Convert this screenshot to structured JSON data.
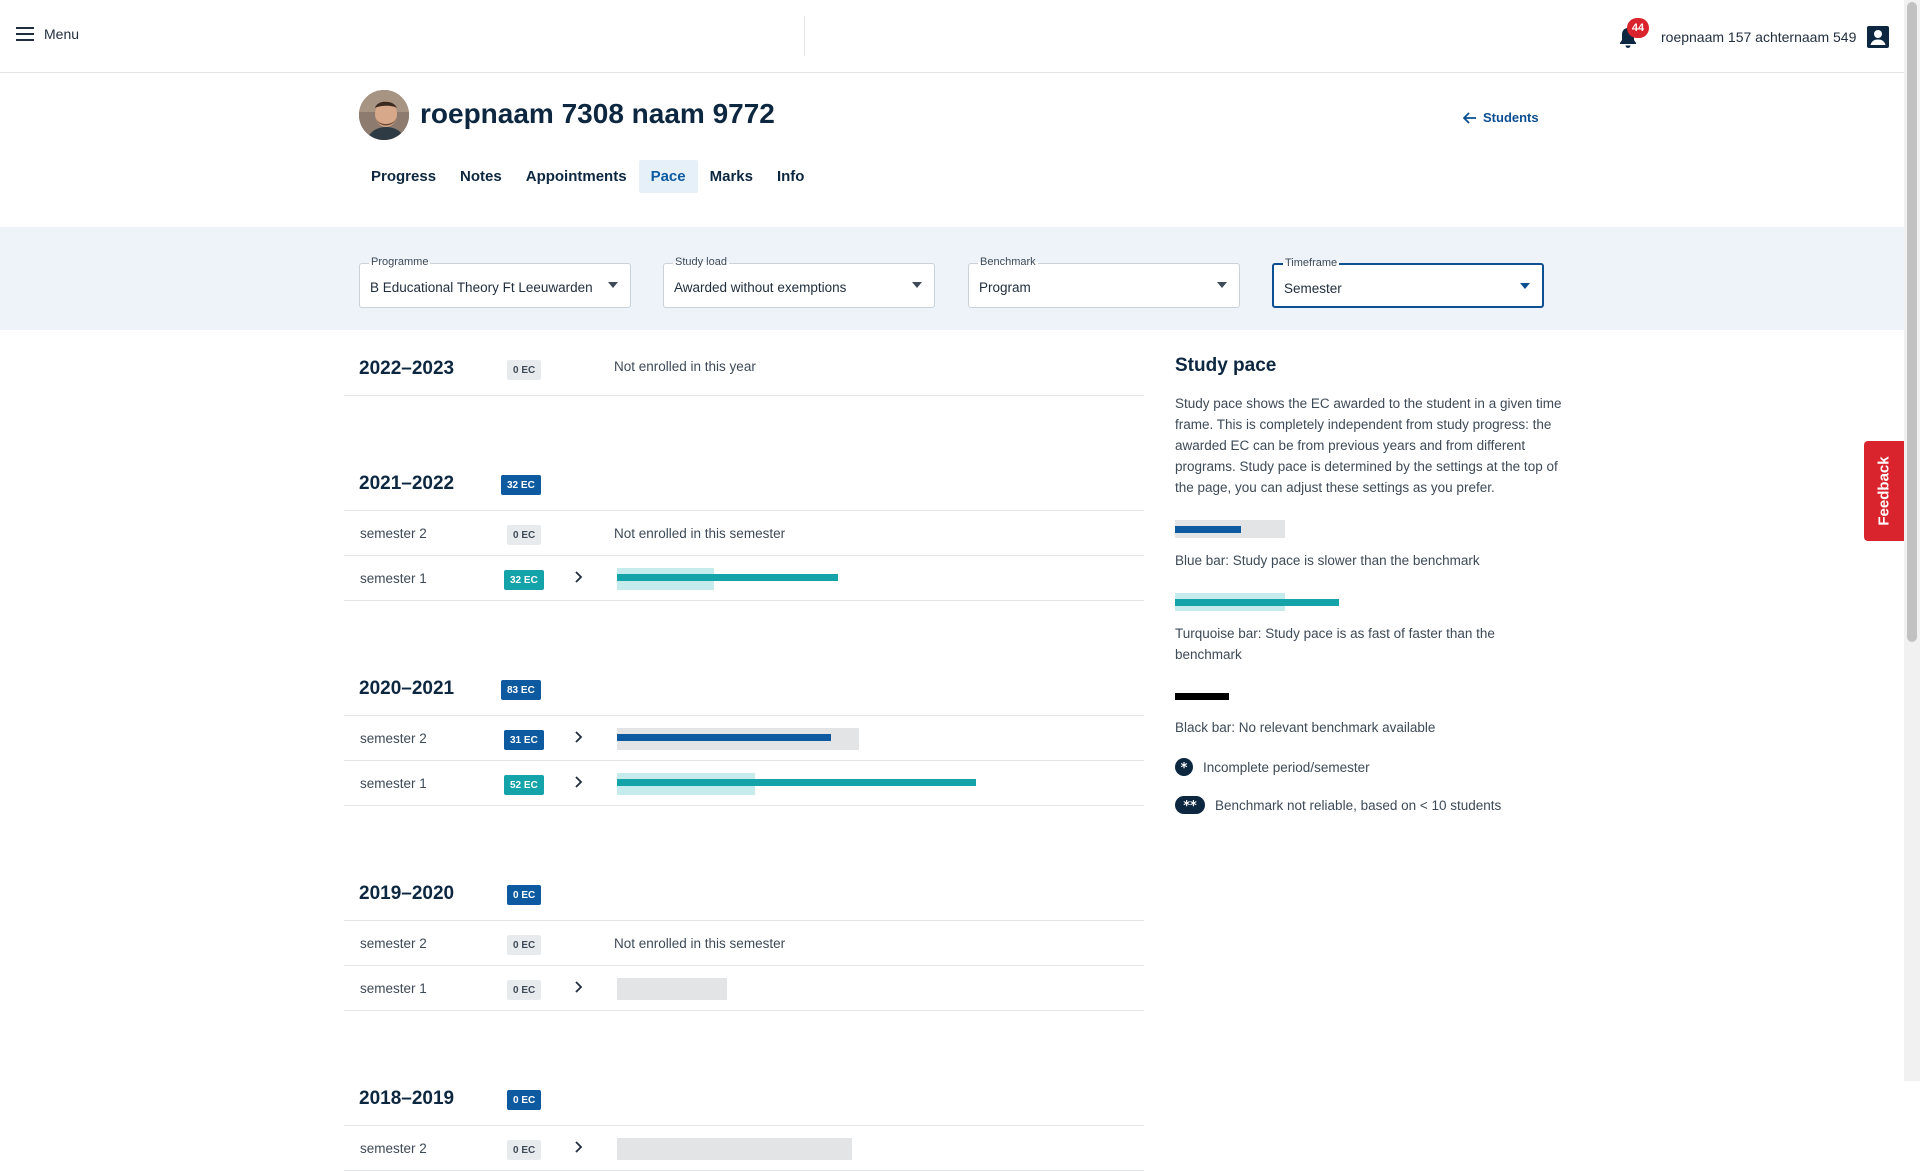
{
  "topbar": {
    "menu_label": "Menu",
    "notifications_count": "44",
    "username": "roepnaam 157 achternaam 549"
  },
  "student": {
    "name": "roepnaam 7308 naam 9772",
    "back_label": "Students"
  },
  "tabs": [
    {
      "label": "Progress",
      "active": false
    },
    {
      "label": "Notes",
      "active": false
    },
    {
      "label": "Appointments",
      "active": false
    },
    {
      "label": "Pace",
      "active": true
    },
    {
      "label": "Marks",
      "active": false
    },
    {
      "label": "Info",
      "active": false
    }
  ],
  "filters": {
    "programme": {
      "label": "Programme",
      "value": "B Educational Theory Ft Leeuwarden"
    },
    "study_load": {
      "label": "Study load",
      "value": "Awarded without exemptions"
    },
    "benchmark": {
      "label": "Benchmark",
      "value": "Program"
    },
    "timeframe": {
      "label": "Timeframe",
      "value": "Semester"
    }
  },
  "years": [
    {
      "title": "2022–2023",
      "ec": "0 EC",
      "ec_style": "grey",
      "note": "Not enrolled in this year",
      "semesters": []
    },
    {
      "title": "2021–2022",
      "ec": "32 EC",
      "ec_style": "blue",
      "note": "",
      "semesters": [
        {
          "label": "semester 2",
          "ec": "0 EC",
          "ec_style": "grey",
          "note": "Not enrolled in this semester",
          "bar": null
        },
        {
          "label": "semester 1",
          "ec": "32 EC",
          "ec_style": "teal",
          "note": "",
          "bar": {
            "benchmark_ec": 14,
            "awarded_ec": 32,
            "kind": "turquoise"
          }
        }
      ]
    },
    {
      "title": "2020–2021",
      "ec": "83 EC",
      "ec_style": "blue",
      "note": "",
      "semesters": [
        {
          "label": "semester 2",
          "ec": "31 EC",
          "ec_style": "blue",
          "note": "",
          "bar": {
            "benchmark_ec": 35,
            "awarded_ec": 31,
            "kind": "blue"
          }
        },
        {
          "label": "semester 1",
          "ec": "52 EC",
          "ec_style": "teal",
          "note": "",
          "bar": {
            "benchmark_ec": 20,
            "awarded_ec": 52,
            "kind": "turquoise"
          }
        }
      ]
    },
    {
      "title": "2019–2020",
      "ec": "0 EC",
      "ec_style": "blue",
      "note": "",
      "semesters": [
        {
          "label": "semester 2",
          "ec": "0 EC",
          "ec_style": "grey",
          "note": "Not enrolled in this semester",
          "bar": null
        },
        {
          "label": "semester 1",
          "ec": "0 EC",
          "ec_style": "grey",
          "note": "",
          "bar": {
            "benchmark_ec": 16,
            "awarded_ec": 0,
            "kind": "blue"
          }
        }
      ]
    },
    {
      "title": "2018–2019",
      "ec": "0 EC",
      "ec_style": "blue",
      "note": "",
      "semesters": [
        {
          "label": "semester 2",
          "ec": "0 EC",
          "ec_style": "grey",
          "note": "",
          "bar": {
            "benchmark_ec": 34,
            "awarded_ec": 0,
            "kind": "blue"
          }
        }
      ]
    }
  ],
  "legend": {
    "title": "Study pace",
    "description": "Study pace shows the EC awarded to the student in a given time frame. This is completely independent from study progress: the awarded EC can be from previous years and from different programs. Study pace is determined by the settings at the top of the page, you can adjust these settings as you prefer.",
    "blue_caption": "Blue bar: Study pace is slower than the benchmark",
    "turquoise_caption": "Turquoise bar: Study pace is as fast of faster than the benchmark",
    "black_caption": "Black bar: No relevant benchmark available",
    "incomplete_caption": "Incomplete period/semester",
    "unreliable_caption": "Benchmark not reliable, based on < 10 students"
  },
  "feedback_label": "Feedback",
  "colors": {
    "blue": "#0d5aa0",
    "turquoise": "#14a3a8",
    "turquoise_light": "#c5ebed",
    "grey_bar": "#e2e4e6",
    "alert_red": "#d9232d"
  }
}
